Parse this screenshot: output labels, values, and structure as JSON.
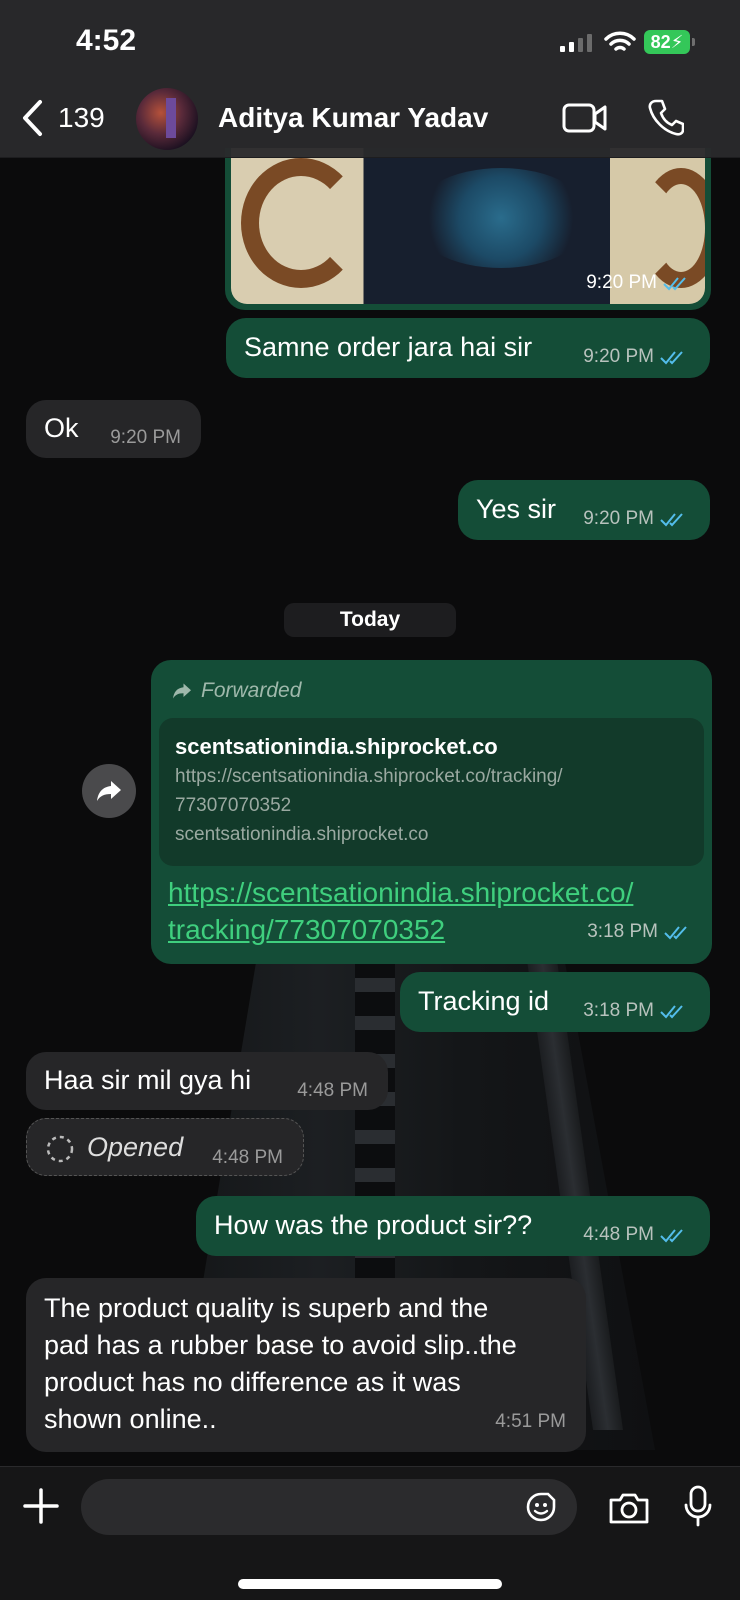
{
  "status_bar": {
    "time": "4:52",
    "battery": "82"
  },
  "header": {
    "back_count": "139",
    "contact_name": "Aditya Kumar Yadav"
  },
  "messages": [
    {
      "kind": "image",
      "direction": "outgoing",
      "time": "9:20 PM"
    },
    {
      "direction": "outgoing",
      "text": "Samne order jara hai sir",
      "time": "9:20 PM"
    },
    {
      "direction": "incoming",
      "text": "Ok",
      "time": "9:20 PM"
    },
    {
      "direction": "outgoing",
      "text": "Yes sir",
      "time": "9:20 PM"
    },
    {
      "kind": "forwarded_link",
      "direction": "outgoing",
      "forwarded_label": "Forwarded",
      "preview_title": "scentsationindia.shiprocket.co",
      "preview_url_line1": "https://scentsationindia.shiprocket.co/tracking/",
      "preview_url_line2": "77307070352",
      "preview_domain": "scentsationindia.shiprocket.co",
      "link_line1": "https://scentsationindia.shiprocket.co/",
      "link_line2": "tracking/77307070352",
      "time": "3:18 PM"
    },
    {
      "direction": "outgoing",
      "text": "Tracking id",
      "time": "3:18 PM"
    },
    {
      "direction": "incoming",
      "text": "Haa sir mil gya hi",
      "time": "4:48 PM"
    },
    {
      "kind": "view_once",
      "direction": "incoming",
      "text": "Opened",
      "time": "4:48 PM"
    },
    {
      "direction": "outgoing",
      "text": "How was the product sir??",
      "time": "4:48 PM"
    },
    {
      "direction": "incoming",
      "lines": [
        "The product quality is superb and the",
        "pad has a rubber base to avoid slip..the",
        "product has no difference as it was",
        "shown online.."
      ],
      "time": "4:51 PM"
    }
  ],
  "date_divider": "Today",
  "input_bar": {
    "placeholder": ""
  },
  "colors": {
    "outgoing_bubble": "#144d37",
    "incoming_bubble": "#262628",
    "link": "#3fcf7e",
    "read_tick": "#53bdeb"
  }
}
